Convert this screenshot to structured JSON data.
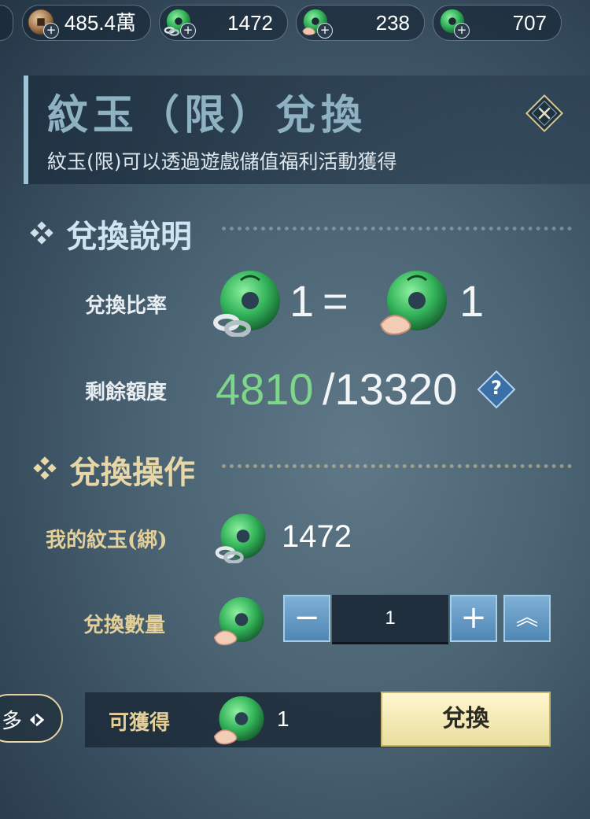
{
  "currency_bar": [
    {
      "icon": "copper-coin-icon",
      "value": "485.4萬"
    },
    {
      "icon": "jade-bound-icon",
      "value": "1472"
    },
    {
      "icon": "jade-limited-icon",
      "value": "238"
    },
    {
      "icon": "jade-icon",
      "value": "707"
    }
  ],
  "header": {
    "title": "紋玉（限）兌換",
    "subtitle": "紋玉(限)可以透過遊戲儲值福利活動獲得"
  },
  "explain": {
    "title": "兌換說明",
    "rate_label": "兌換比率",
    "rate_left": "1",
    "rate_eq": "=",
    "rate_right": "1",
    "quota_label": "剩餘額度",
    "quota_remaining": "4810",
    "quota_total": "/13320",
    "help": "?"
  },
  "operation": {
    "title": "兌換操作",
    "my_label": "我的紋玉(綁)",
    "my_value": "1472",
    "qty_label": "兌換數量",
    "minus": "−",
    "quantity": "1",
    "plus": "+",
    "max": "︽"
  },
  "bottom": {
    "more_label": "多",
    "obtain_label": "可獲得",
    "obtain_value": "1",
    "exchange_button": "兌換"
  },
  "colors": {
    "accent_green": "#7ed68a",
    "gold_label": "#e3cf9a",
    "title_blue": "#8fb2c2",
    "button_blue": "#5f97c4"
  }
}
